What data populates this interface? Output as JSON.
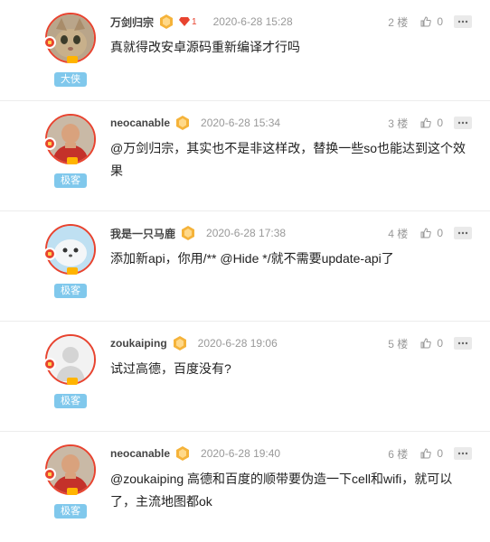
{
  "comments": [
    {
      "username": "万剑归宗",
      "medal": "medal-icon",
      "gem_count": "1",
      "time": "2020-6-28 15:28",
      "floor": "2 楼",
      "likes": "0",
      "level": "大侠",
      "content": "真就得改安卓源码重新编译才行吗"
    },
    {
      "username": "neocanable",
      "medal": "medal-icon",
      "time": "2020-6-28 15:34",
      "floor": "3 楼",
      "likes": "0",
      "level": "极客",
      "content": "@万剑归宗，其实也不是非这样改，替换一些so也能达到这个效果"
    },
    {
      "username": "我是一只马鹿",
      "medal": "medal-icon",
      "time": "2020-6-28 17:38",
      "floor": "4 楼",
      "likes": "0",
      "level": "极客",
      "content": "添加新api，你用/** @Hide */就不需要update-api了"
    },
    {
      "username": "zoukaiping",
      "medal": "medal-icon",
      "time": "2020-6-28 19:06",
      "floor": "5 楼",
      "likes": "0",
      "level": "极客",
      "content": "试过高德，百度没有?"
    },
    {
      "username": "neocanable",
      "medal": "medal-icon",
      "time": "2020-6-28 19:40",
      "floor": "6 楼",
      "likes": "0",
      "level": "极客",
      "content": "@zoukaiping 高德和百度的顺带要伪造一下cell和wifi，就可以了，主流地图都ok"
    }
  ],
  "colors": {
    "accent": "#e8432f",
    "badge": "#80c8ec",
    "medal": "#f5b33a"
  }
}
